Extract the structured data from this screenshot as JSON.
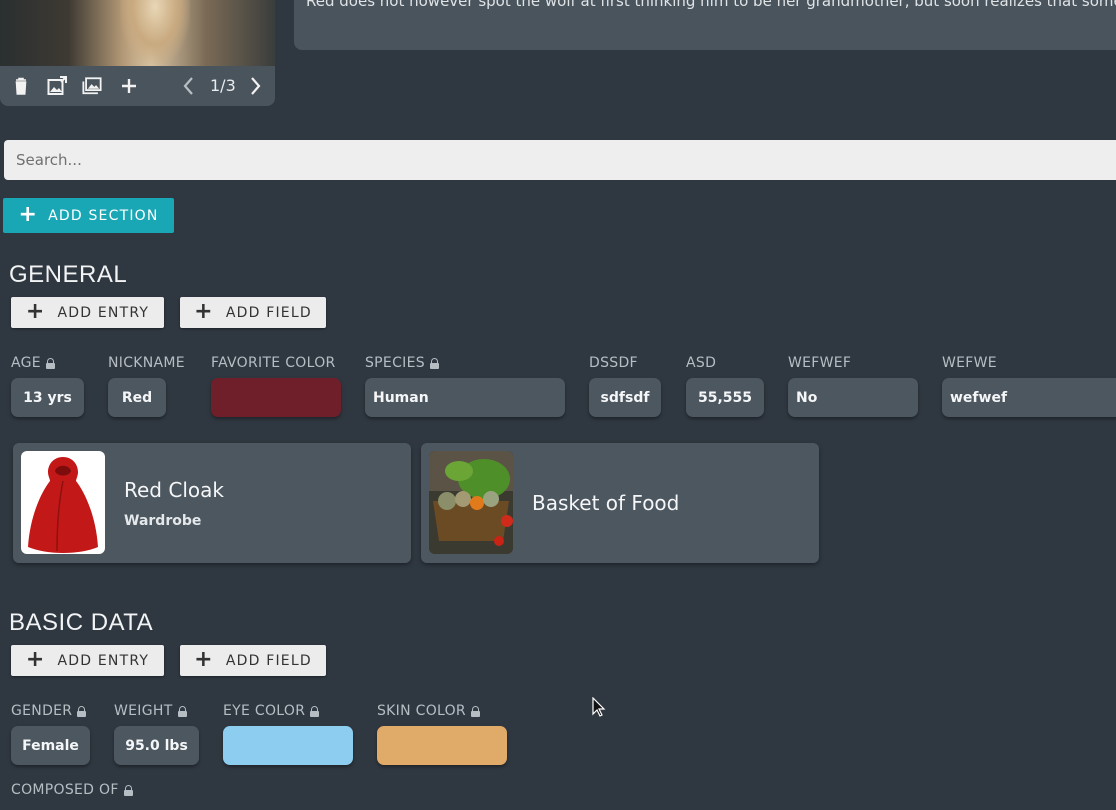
{
  "image_viewer": {
    "pager": "1/3",
    "tools": [
      "trash-icon",
      "image-export-icon",
      "gallery-icon",
      "add-icon",
      "chevron-left-icon",
      "chevron-right-icon"
    ]
  },
  "description": {
    "text": "Red does not however spot the wolf at first thinking him to be her grandmother, but soon realizes that somethin"
  },
  "search": {
    "placeholder": "Search..."
  },
  "add_section": {
    "label": "ADD SECTION"
  },
  "sections": [
    {
      "title": "GENERAL",
      "add_entry_label": "ADD ENTRY",
      "add_field_label": "ADD FIELD",
      "fields": [
        {
          "label": "AGE",
          "locked": true,
          "value": "13 yrs"
        },
        {
          "label": "NICKNAME",
          "locked": false,
          "value": "Red"
        },
        {
          "label": "FAVORITE COLOR",
          "locked": false,
          "color": "#6e1f2a"
        },
        {
          "label": "SPECIES",
          "locked": true,
          "value": "Human"
        },
        {
          "label": "DSSDF",
          "locked": false,
          "value": "sdfsdf"
        },
        {
          "label": "ASD",
          "locked": false,
          "value": "55,555"
        },
        {
          "label": "WEFWEF",
          "locked": false,
          "value": "No"
        },
        {
          "label": "WEFWE",
          "locked": false,
          "value": "wefwef"
        }
      ],
      "entries": [
        {
          "title": "Red Cloak",
          "subtitle": "Wardrobe"
        },
        {
          "title": "Basket of Food",
          "subtitle": ""
        }
      ]
    },
    {
      "title": "BASIC DATA",
      "add_entry_label": "ADD ENTRY",
      "add_field_label": "ADD FIELD",
      "fields": [
        {
          "label": "GENDER",
          "locked": true,
          "value": "Female"
        },
        {
          "label": "WEIGHT",
          "locked": true,
          "value": "95.0 lbs"
        },
        {
          "label": "EYE COLOR",
          "locked": true,
          "color": "#8ccdf0"
        },
        {
          "label": "SKIN COLOR",
          "locked": true,
          "color": "#e0aa68"
        },
        {
          "label": "COMPOSED OF",
          "locked": true
        }
      ]
    }
  ],
  "colors": {
    "background": "#2f3740",
    "card": "#4d5760",
    "accent": "#1aa7b5"
  }
}
